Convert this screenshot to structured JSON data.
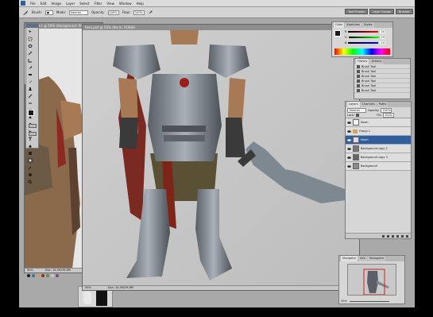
{
  "menu": [
    "File",
    "Edit",
    "Image",
    "Layer",
    "Select",
    "Filter",
    "View",
    "Window",
    "Help"
  ],
  "options": {
    "tool_label": "Brush:",
    "mode_label": "Mode:",
    "mode_value": "Normal",
    "opacity_label": "Opacity:",
    "opacity_value": "100%",
    "flow_label": "Flow:",
    "flow_value": "100%"
  },
  "palette_well": [
    "Tool Presets",
    "Layer Comps",
    "Brushes"
  ],
  "documents": {
    "main_title": "hero.psd @ 50% (Norm, RGB/8)",
    "main_zoom": "50%",
    "main_doc_size": "Doc: 10.4M/39.8M",
    "back_title": "Untitled-1 @ 50% (Background, RGB/8)",
    "back_zoom": "50%",
    "back_doc_size": "Doc: 10.4M/39.8M"
  },
  "color_panel": {
    "tabs": [
      "Color",
      "Swatches",
      "Styles"
    ],
    "channels": [
      {
        "label": "R",
        "value": "24"
      },
      {
        "label": "G",
        "value": "24"
      },
      {
        "label": "B",
        "value": "24"
      }
    ],
    "colors": {
      "fg": "#1a1a1a",
      "bg": "#ffffff"
    }
  },
  "history_panel": {
    "tabs": [
      "History",
      "Actions"
    ],
    "items": [
      "Brush Tool",
      "Brush Tool",
      "Brush Tool",
      "Brush Tool",
      "Brush Tool",
      "Brush Tool"
    ]
  },
  "layers_panel": {
    "tabs": [
      "Layers",
      "Channels",
      "Paths"
    ],
    "blend_mode": "Normal",
    "opacity_label": "Opacity:",
    "opacity_value": "100%",
    "lock_label": "Lock:",
    "fill_label": "Fill:",
    "fill_value": "100%",
    "layers": [
      {
        "name": "Norm",
        "selected": false
      },
      {
        "name": "Group 1",
        "selected": false
      },
      {
        "name": "Norm",
        "selected": true
      },
      {
        "name": "Background copy 2",
        "selected": false
      },
      {
        "name": "Background copy 3",
        "selected": false
      },
      {
        "name": "Background",
        "selected": false
      }
    ]
  },
  "navigator": {
    "tabs": [
      "Navigator",
      "Info",
      "Histogram"
    ],
    "zoom": "50%"
  },
  "swatch_colors": [
    "#1c1c1c",
    "#3a6fa5",
    "#c5a25a",
    "#8c2f2a",
    "#6b8c4a",
    "#c9c9c9",
    "#7a4a8a",
    "#d9d9d9"
  ]
}
